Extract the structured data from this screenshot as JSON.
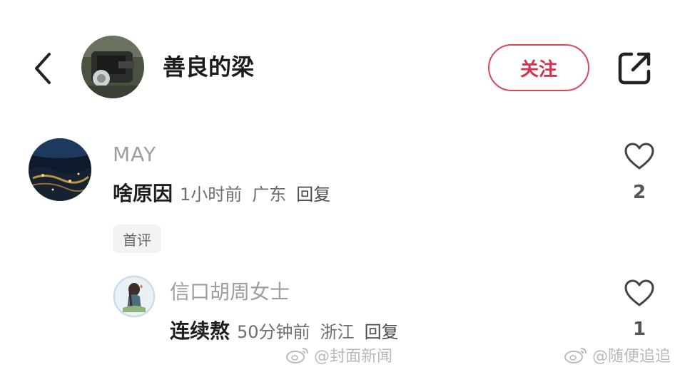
{
  "header": {
    "back_icon": "chevron-left-icon",
    "author_name": "善良的梁",
    "follow_label": "关注",
    "share_icon": "external-share-icon",
    "accent_color": "#d8314d"
  },
  "comments": [
    {
      "author": "MAY",
      "text": "啥原因",
      "time": "1小时前",
      "location": "广东",
      "reply_label": "回复",
      "tag": "首评",
      "like_count": "2"
    },
    {
      "author": "信口胡周女士",
      "text": "连续熬",
      "time": "50分钟前",
      "location": "浙江",
      "reply_label": "回复",
      "like_count": "1"
    }
  ],
  "watermarks": [
    {
      "icon": "weibo-icon",
      "text": "@封面新闻"
    },
    {
      "icon": "weibo-icon",
      "text": "@随便追追"
    }
  ]
}
